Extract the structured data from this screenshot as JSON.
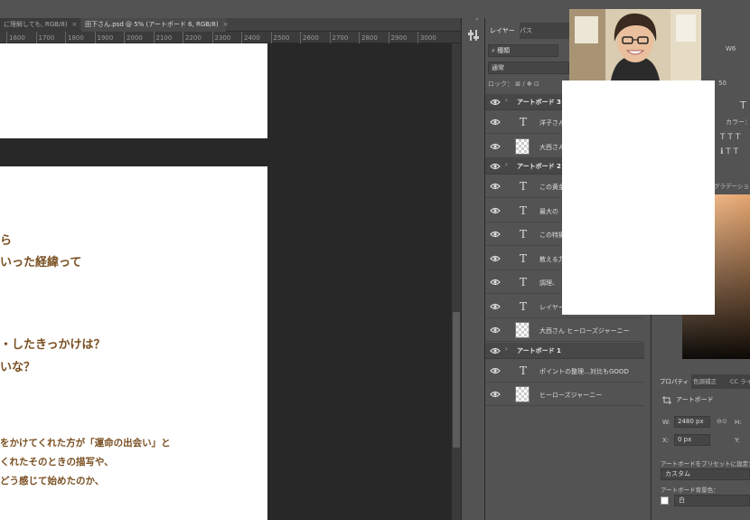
{
  "document_tabs": [
    {
      "label": "に理解しても, RGB/8)",
      "close": "×"
    },
    {
      "label": "田下さん.psd @ 5% (アートボード 6, RGB/8)",
      "close": "×"
    }
  ],
  "ruler": {
    "ticks": [
      "1600",
      "1700",
      "1800",
      "1900",
      "2000",
      "2100",
      "2200",
      "2300",
      "2400",
      "2500",
      "2600",
      "2700",
      "2800",
      "2900",
      "3000"
    ]
  },
  "artboard_text": {
    "big_lines": [
      "ら",
      "いった経緯って",
      "・したきっかけは？",
      "いな？"
    ],
    "small_lines": [
      "をかけてくれた方が「運命の出会い」と",
      "くれたそのときの描写や、",
      "どう感じて始めたのか、"
    ]
  },
  "panel_tabs": {
    "layers": "レイヤー",
    "paths": "パス"
  },
  "layers_controls": {
    "filter": "種類",
    "blend_mode": "通常",
    "lock_label": "ロック："
  },
  "layers": [
    {
      "kind": "group",
      "name": "アートボード 3"
    },
    {
      "kind": "text",
      "name": "洋子さん"
    },
    {
      "kind": "image",
      "name": "大西さん"
    },
    {
      "kind": "group",
      "name": "アートボード 2"
    },
    {
      "kind": "text",
      "name": "この黄金"
    },
    {
      "kind": "text",
      "name": "最大の"
    },
    {
      "kind": "text",
      "name": "この特撮"
    },
    {
      "kind": "text",
      "name": "教える力"
    },
    {
      "kind": "text",
      "name": "調理、"
    },
    {
      "kind": "text",
      "name": "レイヤー"
    },
    {
      "kind": "image",
      "name": "大西さん ヒーローズジャーニー"
    },
    {
      "kind": "group",
      "name": "アートボード 1"
    },
    {
      "kind": "text",
      "name": "ポイントの整理…対比もGOOD"
    },
    {
      "kind": "image",
      "name": "ヒーローズジャーニー"
    }
  ],
  "character_panel": {
    "font_label_fragment": "W6",
    "size_value": "50",
    "color_label": "カラー：",
    "gradient_tab": "グラデーション"
  },
  "properties_panel": {
    "tabs": [
      "プロパティ",
      "色調補正",
      "CC ライ"
    ],
    "type_label": "アートボード",
    "w_label": "W:",
    "w_value": "2480 px",
    "link_glyph": "⊖⊙",
    "h_label": "H:",
    "x_label": "X:",
    "x_value": "0 px",
    "y_label": "Y:",
    "preset_label": "アートボードをプリセットに設定：",
    "preset_value": "カスタム",
    "bg_label": "アートボード背景色：",
    "bg_value": "白"
  },
  "colors": {
    "artboard_text": "#7a4f22",
    "panel_bg": "#535353",
    "canvas_bg": "#282828"
  }
}
